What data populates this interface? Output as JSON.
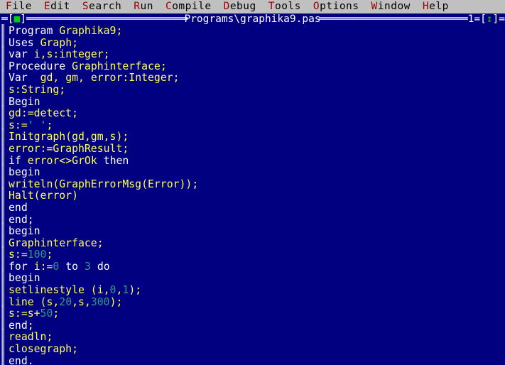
{
  "menu": {
    "items": [
      {
        "hot": "F",
        "rest": "ile"
      },
      {
        "hot": "E",
        "rest": "dit"
      },
      {
        "hot": "S",
        "rest": "earch"
      },
      {
        "hot": "R",
        "rest": "un"
      },
      {
        "hot": "C",
        "rest": "ompile"
      },
      {
        "hot": "D",
        "rest": "ebug"
      },
      {
        "hot": "T",
        "rest": "ools"
      },
      {
        "hot": "O",
        "rest": "ptions"
      },
      {
        "hot": "W",
        "rest": "indow"
      },
      {
        "hot": "H",
        "rest": "elp"
      }
    ]
  },
  "window": {
    "title": "Programs\\graphika9.pas",
    "close_box_left": "[",
    "close_box_glyph": "■",
    "close_box_right": "]",
    "frame_dash": "═",
    "window_number": "1",
    "resize_box_left": "[",
    "resize_box_glyph": "↕",
    "resize_box_right": "]",
    "left_border_glyph": "║"
  },
  "colors": {
    "editor_background": "#000080",
    "menu_background": "#c0c0c0",
    "menu_text": "#000000",
    "menu_hotkey": "#9c0000",
    "keyword": "#ffffff",
    "identifier": "#ffff55",
    "number": "#2e9b80",
    "string": "#00cccc",
    "frame": "#ffffff",
    "accent_green": "#00d000"
  },
  "editor": {
    "lines": [
      [
        {
          "t": "Program",
          "c": "key"
        },
        {
          "t": " ",
          "c": "plain"
        },
        {
          "t": "Graphika9;",
          "c": "id"
        }
      ],
      [
        {
          "t": "Uses",
          "c": "key"
        },
        {
          "t": " ",
          "c": "plain"
        },
        {
          "t": "Graph;",
          "c": "id"
        }
      ],
      [
        {
          "t": "var",
          "c": "key"
        },
        {
          "t": " ",
          "c": "plain"
        },
        {
          "t": "i,s:integer;",
          "c": "id"
        }
      ],
      [
        {
          "t": "Procedure",
          "c": "key"
        },
        {
          "t": " ",
          "c": "plain"
        },
        {
          "t": "Graphinterface;",
          "c": "id"
        }
      ],
      [
        {
          "t": "Var",
          "c": "key"
        },
        {
          "t": "  ",
          "c": "plain"
        },
        {
          "t": "gd, gm, error:Integer;",
          "c": "id"
        }
      ],
      [
        {
          "t": "s:String;",
          "c": "id"
        }
      ],
      [
        {
          "t": "Begin",
          "c": "key"
        }
      ],
      [
        {
          "t": "gd:=detect;",
          "c": "id"
        }
      ],
      [
        {
          "t": "s:=",
          "c": "id"
        },
        {
          "t": "' '",
          "c": "str"
        },
        {
          "t": ";",
          "c": "id"
        }
      ],
      [
        {
          "t": "Initgraph(gd,gm,s);",
          "c": "id"
        }
      ],
      [
        {
          "t": "error:=GraphResult;",
          "c": "id"
        }
      ],
      [
        {
          "t": "if",
          "c": "key"
        },
        {
          "t": " ",
          "c": "plain"
        },
        {
          "t": "error<>GrOk",
          "c": "id"
        },
        {
          "t": " ",
          "c": "plain"
        },
        {
          "t": "then",
          "c": "key"
        }
      ],
      [
        {
          "t": "begin",
          "c": "key"
        }
      ],
      [
        {
          "t": "writeln(GraphErrorMsg(Error));",
          "c": "id"
        }
      ],
      [
        {
          "t": "Halt(error)",
          "c": "id"
        }
      ],
      [
        {
          "t": "end",
          "c": "key"
        }
      ],
      [
        {
          "t": "end;",
          "c": "key"
        }
      ],
      [
        {
          "t": "begin",
          "c": "key"
        }
      ],
      [
        {
          "t": "Graphinterface;",
          "c": "id"
        }
      ],
      [
        {
          "t": "s:=",
          "c": "id"
        },
        {
          "t": "100",
          "c": "num"
        },
        {
          "t": ";",
          "c": "id"
        }
      ],
      [
        {
          "t": "for",
          "c": "key"
        },
        {
          "t": " ",
          "c": "plain"
        },
        {
          "t": "i:=",
          "c": "id"
        },
        {
          "t": "0",
          "c": "num"
        },
        {
          "t": " ",
          "c": "plain"
        },
        {
          "t": "to",
          "c": "key"
        },
        {
          "t": " ",
          "c": "plain"
        },
        {
          "t": "3",
          "c": "num"
        },
        {
          "t": " ",
          "c": "plain"
        },
        {
          "t": "do",
          "c": "key"
        }
      ],
      [
        {
          "t": "begin",
          "c": "key"
        }
      ],
      [
        {
          "t": "setlinestyle (i,",
          "c": "id"
        },
        {
          "t": "0",
          "c": "num"
        },
        {
          "t": ",",
          "c": "id"
        },
        {
          "t": "1",
          "c": "num"
        },
        {
          "t": ");",
          "c": "id"
        }
      ],
      [
        {
          "t": "line (s,",
          "c": "id"
        },
        {
          "t": "20",
          "c": "num"
        },
        {
          "t": ",s,",
          "c": "id"
        },
        {
          "t": "300",
          "c": "num"
        },
        {
          "t": ");",
          "c": "id"
        }
      ],
      [
        {
          "t": "s:=s+",
          "c": "id"
        },
        {
          "t": "50",
          "c": "num"
        },
        {
          "t": ";",
          "c": "id"
        }
      ],
      [
        {
          "t": "end;",
          "c": "key"
        }
      ],
      [
        {
          "t": "readln;",
          "c": "id"
        }
      ],
      [
        {
          "t": "closegraph;",
          "c": "id"
        }
      ],
      [
        {
          "t": "end.",
          "c": "key"
        }
      ]
    ]
  }
}
